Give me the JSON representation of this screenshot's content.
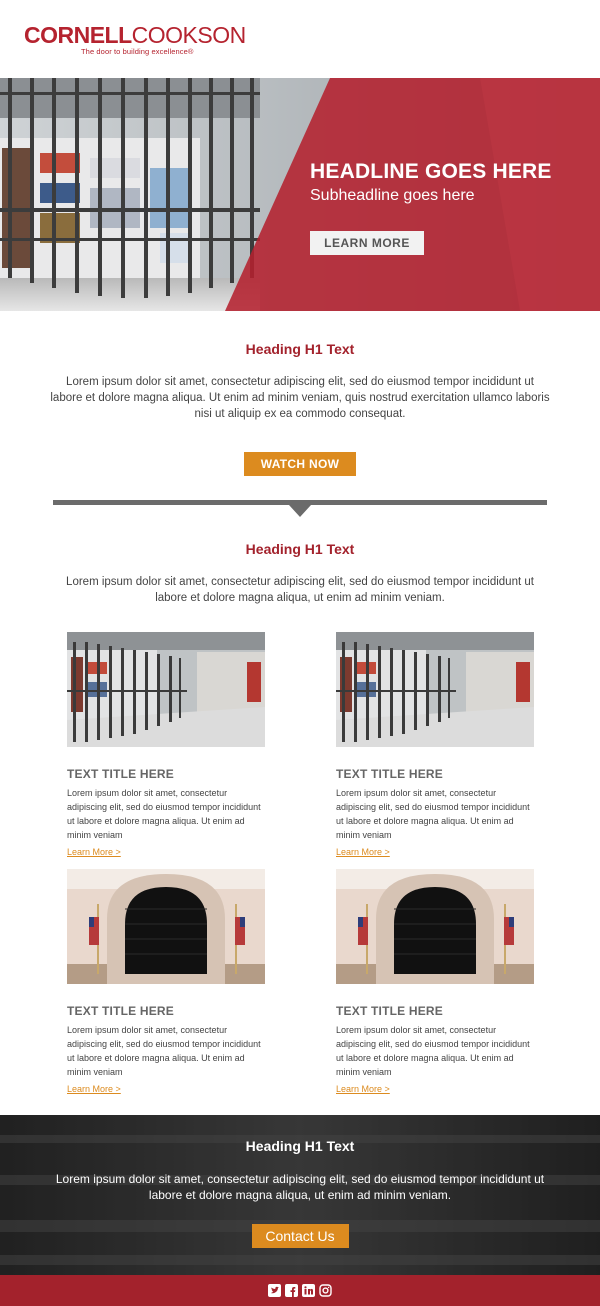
{
  "brand": {
    "logo_bold": "CORNELL",
    "logo_thin": "COOKSON",
    "tagline": "The door to building excellence®",
    "accent": "#a3222c",
    "cta_color": "#dc8b1f"
  },
  "hero": {
    "headline": "HEADLINE GOES HERE",
    "subheadline": "Subheadline goes here",
    "button": "LEARN MORE"
  },
  "intro": {
    "heading": "Heading H1 Text",
    "body": "Lorem ipsum dolor sit amet, consectetur adipiscing elit, sed do eiusmod tempor incididunt ut labore et dolore magna aliqua. Ut enim ad minim veniam, quis nostrud exercitation ullamco laboris nisi ut aliquip ex ea commodo consequat.",
    "button": "WATCH NOW"
  },
  "products": {
    "heading": "Heading H1 Text",
    "body": "Lorem ipsum dolor sit amet, consectetur adipiscing elit, sed do eiusmod tempor incididunt ut labore et dolore magna aliqua, ut enim ad minim veniam.",
    "cards": [
      {
        "title": "TEXT TITLE HERE",
        "text": "Lorem ipsum dolor sit amet, consectetur adipiscing elit, sed do eiusmod tempor incididunt ut labore et dolore magna aliqua. Ut enim ad minim veniam",
        "link": "Learn More >"
      },
      {
        "title": "TEXT TITLE HERE",
        "text": "Lorem ipsum dolor sit amet, consectetur adipiscing elit, sed do eiusmod tempor incididunt ut labore et dolore magna aliqua. Ut enim ad minim veniam",
        "link": "Learn More >"
      },
      {
        "title": "TEXT TITLE HERE",
        "text": "Lorem ipsum dolor sit amet, consectetur adipiscing elit, sed do eiusmod tempor incididunt ut labore et dolore magna aliqua. Ut enim ad minim veniam",
        "link": "Learn More >"
      },
      {
        "title": "TEXT TITLE HERE",
        "text": "Lorem ipsum dolor sit amet, consectetur adipiscing elit, sed do eiusmod tempor incididunt ut labore et dolore magna aliqua. Ut enim ad minim veniam",
        "link": "Learn More >"
      }
    ]
  },
  "contact": {
    "heading": "Heading H1 Text",
    "body": "Lorem ipsum dolor sit amet, consectetur adipiscing elit, sed do eiusmod tempor incididunt ut labore et dolore magna aliqua, ut enim ad minim veniam.",
    "button": "Contact Us"
  },
  "social": [
    "twitter-icon",
    "facebook-icon",
    "linkedin-icon",
    "instagram-icon"
  ]
}
